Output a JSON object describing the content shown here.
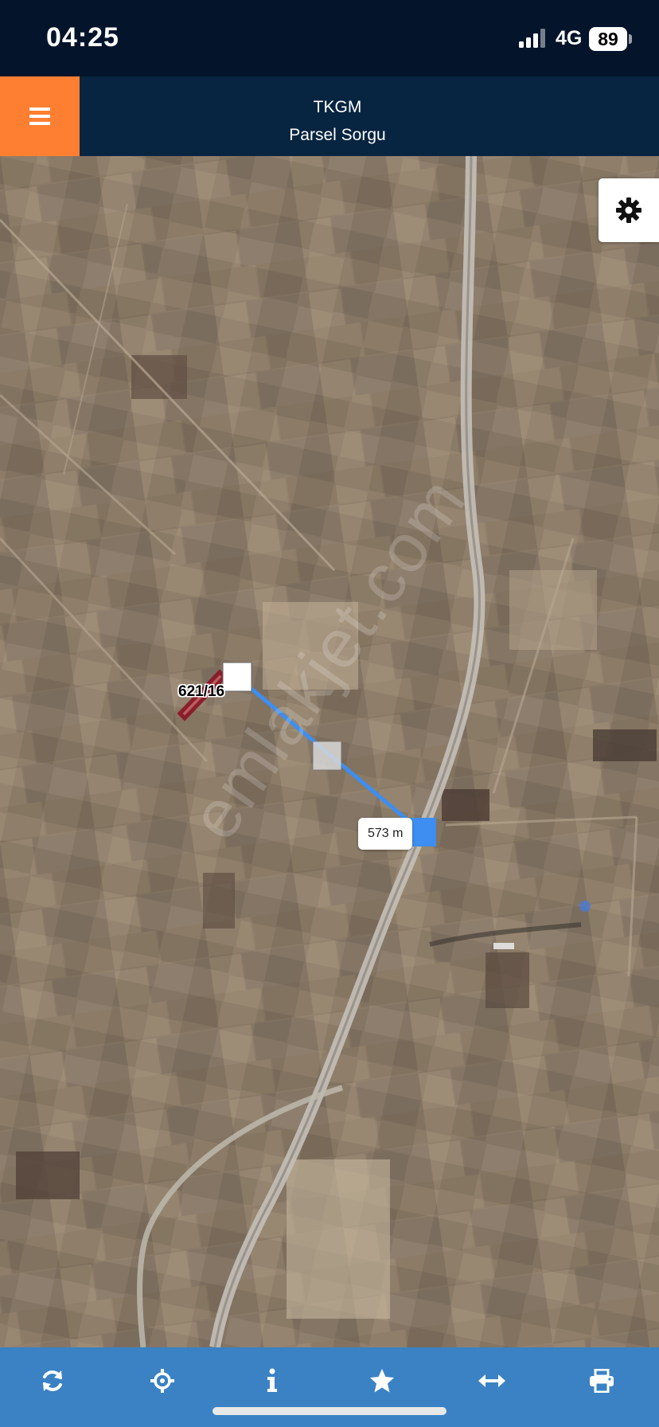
{
  "status_bar": {
    "time": "04:25",
    "network": "4G",
    "battery": "89",
    "icons": [
      "signal-bars-icon",
      "battery-icon"
    ]
  },
  "header": {
    "title": "TKGM",
    "subtitle": "Parsel Sorgu",
    "menu_icon": "hamburger-menu-icon"
  },
  "map": {
    "parcel_label": "621/16",
    "distance_label": "573 m",
    "watermark": "emlakjet.com",
    "settings_icon": "gear-icon"
  },
  "toolbar": {
    "items": [
      {
        "icon": "refresh-icon"
      },
      {
        "icon": "locate-icon"
      },
      {
        "icon": "info-icon"
      },
      {
        "icon": "star-icon"
      },
      {
        "icon": "measure-icon"
      },
      {
        "icon": "print-icon"
      }
    ]
  },
  "colors": {
    "status_bar": "#04142a",
    "header": "#072440",
    "menu_accent": "#ff7f32",
    "toolbar": "#3a82c4",
    "measure_line": "#3d8ef0",
    "parcel_outline": "#8a1526"
  }
}
